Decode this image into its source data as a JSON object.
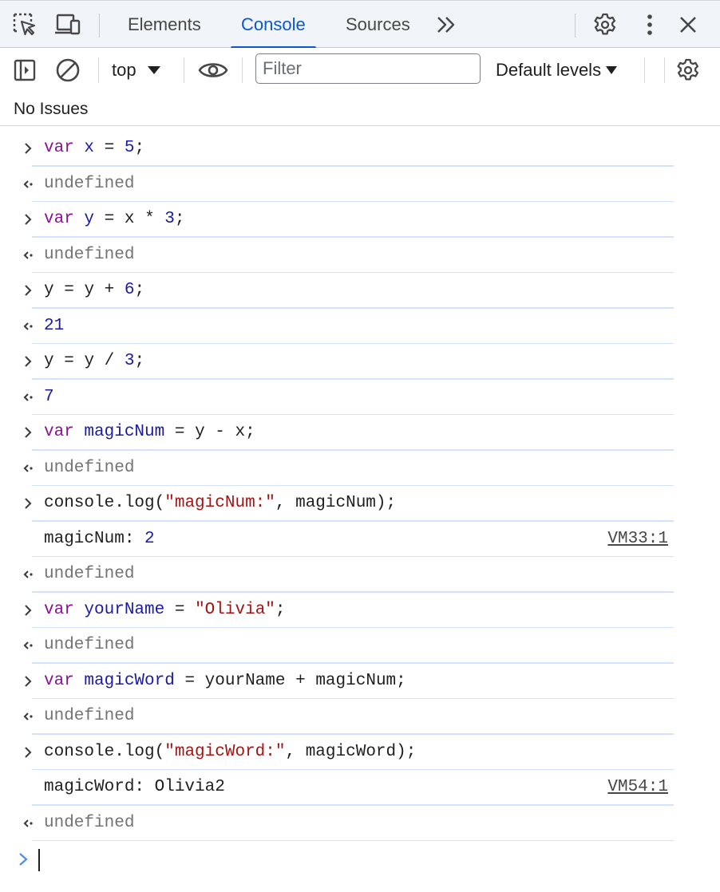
{
  "tabs": {
    "items": [
      {
        "label": "Elements"
      },
      {
        "label": "Console"
      },
      {
        "label": "Sources"
      }
    ],
    "active": "Console"
  },
  "toolbar": {
    "context_value": "top",
    "filter_placeholder": "Filter",
    "levels_label": "Default levels"
  },
  "issues": {
    "text": "No Issues"
  },
  "console": {
    "entries": [
      {
        "type": "input",
        "text": "var x = 5;"
      },
      {
        "type": "result",
        "text": "undefined"
      },
      {
        "type": "input",
        "text": "var y = x * 3;"
      },
      {
        "type": "result",
        "text": "undefined"
      },
      {
        "type": "input",
        "text": "y = y + 6;"
      },
      {
        "type": "result",
        "text": "21"
      },
      {
        "type": "input",
        "text": "y = y / 3;"
      },
      {
        "type": "result",
        "text": "7"
      },
      {
        "type": "input",
        "text": "var magicNum = y - x;"
      },
      {
        "type": "result",
        "text": "undefined"
      },
      {
        "type": "input",
        "text": "console.log(\"magicNum:\", magicNum);"
      },
      {
        "type": "log",
        "text": "magicNum: 2",
        "source": "VM33:1"
      },
      {
        "type": "result",
        "text": "undefined"
      },
      {
        "type": "input",
        "text": "var yourName = \"Olivia\";"
      },
      {
        "type": "result",
        "text": "undefined"
      },
      {
        "type": "input",
        "text": "var magicWord = yourName + magicNum;"
      },
      {
        "type": "result",
        "text": "undefined"
      },
      {
        "type": "input",
        "text": "console.log(\"magicWord:\", magicWord);"
      },
      {
        "type": "log",
        "text": "magicWord: Olivia2",
        "source": "VM54:1"
      },
      {
        "type": "result",
        "text": "undefined"
      }
    ]
  },
  "colors": {
    "accent": "#0b57d0",
    "keyword": "#881391",
    "variable": "#1a1aa6",
    "string": "#a31515",
    "undefined": "#737373",
    "row_divider": "#d3e3fd",
    "tabbar_bg": "#f1f4f9"
  },
  "icons": {
    "inspect": "inspect-element-icon",
    "device": "device-toolbar-icon",
    "more_tabs": "chevron-double-right-icon",
    "settings": "gear-icon",
    "menu": "kebab-menu-icon",
    "close": "close-icon",
    "sidebar": "sidebar-toggle-icon",
    "clear": "clear-console-icon",
    "eye": "live-expression-eye-icon",
    "console_settings": "gear-icon"
  }
}
